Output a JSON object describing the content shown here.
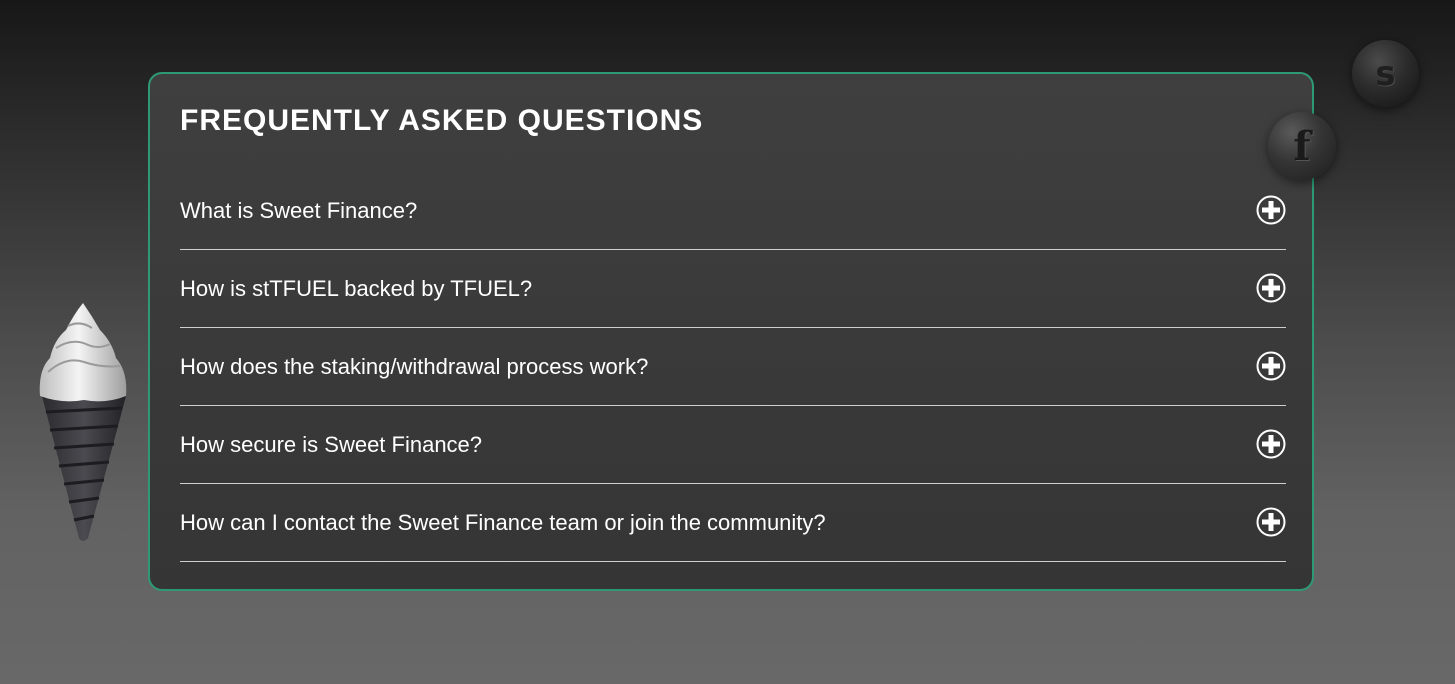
{
  "faq": {
    "title": "FREQUENTLY ASKED QUESTIONS",
    "items": [
      {
        "question": "What is Sweet Finance?",
        "icon": "plus-circle-icon"
      },
      {
        "question": "How is stTFUEL backed by TFUEL?",
        "icon": "plus-circle-icon"
      },
      {
        "question": "How does the staking/withdrawal process work?",
        "icon": "plus-circle-icon"
      },
      {
        "question": "How secure is Sweet Finance?",
        "icon": "plus-circle-icon"
      },
      {
        "question": "How can I contact the Sweet Finance team or join the community?",
        "icon": "plus-circle-icon"
      }
    ]
  },
  "decor": {
    "coin_s_letter": "s",
    "coin_f_letter": "f"
  },
  "colors": {
    "accent_border": "#2e9a73",
    "card_background": "#3a3a3a",
    "text": "#ffffff"
  }
}
